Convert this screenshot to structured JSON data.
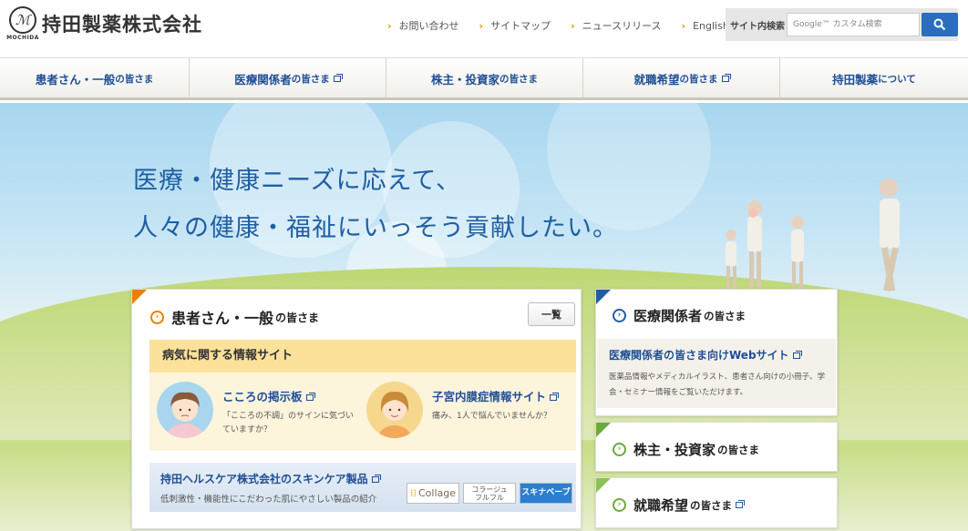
{
  "header": {
    "company_name": "持田製薬株式会社",
    "logo_sub": "MOCHIDA",
    "util_links": [
      "お問い合わせ",
      "サイトマップ",
      "ニュースリリース",
      "English"
    ],
    "search": {
      "label": "サイト内検索",
      "placeholder": "Google™ カスタム検索"
    }
  },
  "nav": [
    {
      "label": "患者さん・一般",
      "suffix": "の皆さま",
      "external": false
    },
    {
      "label": "医療関係者",
      "suffix": "の皆さま",
      "external": true
    },
    {
      "label": "株主・投資家",
      "suffix": "の皆さま",
      "external": false
    },
    {
      "label": "就職希望",
      "suffix": "の皆さま",
      "external": true
    },
    {
      "label": "持田製薬",
      "suffix": "について",
      "external": false
    }
  ],
  "hero": {
    "line1": "医療・健康ニーズに応えて、",
    "line2": "人々の健康・福祉にいっそう貢献したい。"
  },
  "patients": {
    "title": "患者さん・一般",
    "suffix": "の皆さま",
    "list_button": "一覧",
    "section": "病気に関する情報サイト",
    "cards": [
      {
        "title": "こころの掲示板",
        "desc": "「こころの不調」のサインに気づいていますか？"
      },
      {
        "title": "子宮内膜症情報サイト",
        "desc": "痛み、1人で悩んでいませんか？"
      }
    ],
    "skincare": {
      "title": "持田ヘルスケア株式会社のスキンケア製品",
      "desc": "低刺激性・機能性にこだわった肌にやさしい製品の紹介",
      "brands": [
        "Collage",
        "コラージュ\nフルフル",
        "スキナベーブ"
      ]
    }
  },
  "medical": {
    "title": "医療関係者",
    "suffix": "の皆さま",
    "link": "医療関係者の皆さま向けWebサイト",
    "desc": "医薬品情報やメディカルイラスト、患者さん向けの小冊子、学会・セミナー情報をご覧いただけます。"
  },
  "investors": {
    "title": "株主・投資家",
    "suffix": "の皆さま"
  },
  "careers": {
    "title": "就職希望",
    "suffix": "の皆さま"
  },
  "colors": {
    "accent_orange": "#ee7f00",
    "brand_blue": "#1f5ea3",
    "investor_green": "#6aaa3a"
  }
}
